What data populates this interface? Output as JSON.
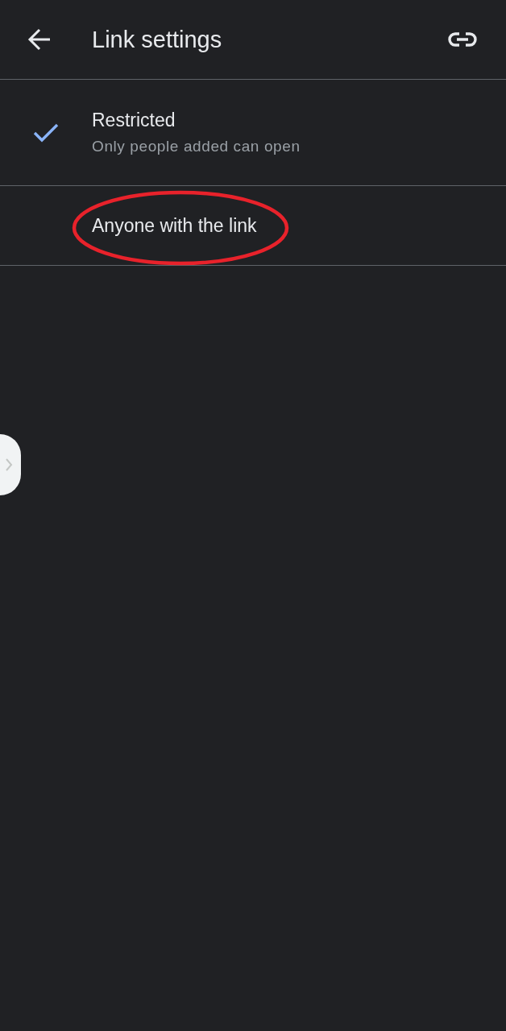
{
  "header": {
    "title": "Link settings"
  },
  "options": [
    {
      "title": "Restricted",
      "subtitle": "Only people added can open",
      "selected": true,
      "circled": false
    },
    {
      "title": "Anyone with the link",
      "selected": false,
      "circled": true
    }
  ],
  "edge_handle": {
    "visible": true
  }
}
